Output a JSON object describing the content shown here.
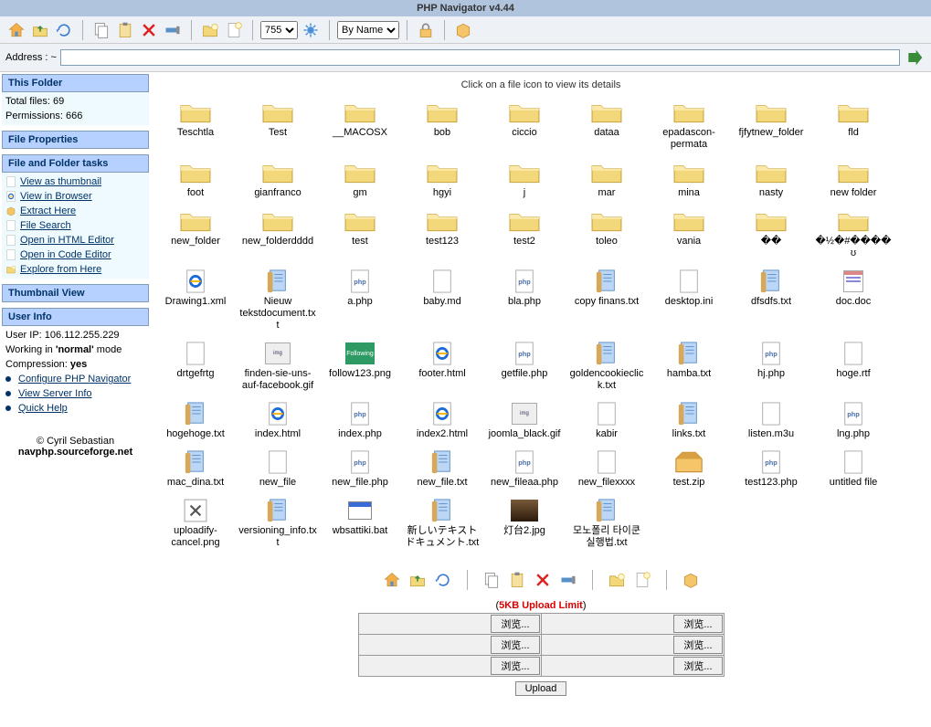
{
  "title": "PHP Navigator v4.44",
  "address_label": "Address : ~",
  "address_value": "",
  "permission_select": "755",
  "sort_select": "By Name",
  "sidebar": {
    "this_folder": {
      "header": "This Folder",
      "total_files": "Total files: 69",
      "permissions": "Permissions: 666"
    },
    "file_properties": {
      "header": "File Properties"
    },
    "tasks": {
      "header": "File and Folder tasks",
      "items": [
        "View as thumbnail",
        "View in Browser",
        "Extract Here",
        "File Search",
        "Open in HTML Editor",
        "Open in Code Editor",
        "Explore from Here"
      ]
    },
    "thumbnail_view": {
      "header": "Thumbnail View"
    },
    "user_info": {
      "header": "User Info",
      "ip_line": "User IP: 106.112.255.229",
      "mode_prefix": "Working in ",
      "mode_bold": "'normal'",
      "mode_suffix": " mode",
      "comp_prefix": "Compression: ",
      "comp_bold": "yes",
      "links": [
        "Configure PHP Navigator",
        "View Server Info",
        "Quick Help"
      ]
    },
    "credit_line1": "© Cyril Sebastian",
    "credit_line2": "navphp.sourceforge.net"
  },
  "hint": "Click on a file icon to view its details",
  "files": [
    {
      "name": "Teschtla",
      "type": "folder"
    },
    {
      "name": "Test",
      "type": "folder"
    },
    {
      "name": "__MACOSX",
      "type": "folder"
    },
    {
      "name": "bob",
      "type": "folder"
    },
    {
      "name": "ciccio",
      "type": "folder"
    },
    {
      "name": "dataa",
      "type": "folder"
    },
    {
      "name": "epadascon-permata",
      "type": "folder"
    },
    {
      "name": "fjfytnew_folder",
      "type": "folder"
    },
    {
      "name": "fld",
      "type": "folder"
    },
    {
      "name": "foot",
      "type": "folder"
    },
    {
      "name": "gianfranco",
      "type": "folder"
    },
    {
      "name": "gm",
      "type": "folder"
    },
    {
      "name": "hgyi",
      "type": "folder"
    },
    {
      "name": "j",
      "type": "folder"
    },
    {
      "name": "mar",
      "type": "folder"
    },
    {
      "name": "mina",
      "type": "folder"
    },
    {
      "name": "nasty",
      "type": "folder"
    },
    {
      "name": "new folder",
      "type": "folder"
    },
    {
      "name": "new_folder",
      "type": "folder"
    },
    {
      "name": "new_folderdddd",
      "type": "folder"
    },
    {
      "name": "test",
      "type": "folder"
    },
    {
      "name": "test123",
      "type": "folder"
    },
    {
      "name": "test2",
      "type": "folder"
    },
    {
      "name": "toleo",
      "type": "folder"
    },
    {
      "name": "vania",
      "type": "folder"
    },
    {
      "name": "��",
      "type": "folder"
    },
    {
      "name": "�½�#����ʊ",
      "type": "folder"
    },
    {
      "name": "Drawing1.xml",
      "type": "ie"
    },
    {
      "name": "Nieuw tekstdocument.txt",
      "type": "txt"
    },
    {
      "name": "a.php",
      "type": "php"
    },
    {
      "name": "baby.md",
      "type": "blank"
    },
    {
      "name": "bla.php",
      "type": "php"
    },
    {
      "name": "copy finans.txt",
      "type": "txt"
    },
    {
      "name": "desktop.ini",
      "type": "blank"
    },
    {
      "name": "dfsdfs.txt",
      "type": "txt"
    },
    {
      "name": "doc.doc",
      "type": "doc"
    },
    {
      "name": "drtgefrtg",
      "type": "blank"
    },
    {
      "name": "finden-sie-uns-auf-facebook.gif",
      "type": "img"
    },
    {
      "name": "follow123.png",
      "type": "img2"
    },
    {
      "name": "footer.html",
      "type": "ie"
    },
    {
      "name": "getfile.php",
      "type": "php"
    },
    {
      "name": "goldencookieclick.txt",
      "type": "txt"
    },
    {
      "name": "hamba.txt",
      "type": "txt"
    },
    {
      "name": "hj.php",
      "type": "php"
    },
    {
      "name": "hoge.rtf",
      "type": "blank"
    },
    {
      "name": "hogehoge.txt",
      "type": "txt"
    },
    {
      "name": "index.html",
      "type": "ie"
    },
    {
      "name": "index.php",
      "type": "php"
    },
    {
      "name": "index2.html",
      "type": "ie"
    },
    {
      "name": "joomla_black.gif",
      "type": "img"
    },
    {
      "name": "kabir",
      "type": "blank"
    },
    {
      "name": "links.txt",
      "type": "txt"
    },
    {
      "name": "listen.m3u",
      "type": "blank"
    },
    {
      "name": "lng.php",
      "type": "php"
    },
    {
      "name": "mac_dina.txt",
      "type": "txt"
    },
    {
      "name": "new_file",
      "type": "blank"
    },
    {
      "name": "new_file.php",
      "type": "php"
    },
    {
      "name": "new_file.txt",
      "type": "txt"
    },
    {
      "name": "new_fileaa.php",
      "type": "php"
    },
    {
      "name": "new_filexxxx",
      "type": "blank"
    },
    {
      "name": "test.zip",
      "type": "zip"
    },
    {
      "name": "test123.php",
      "type": "php"
    },
    {
      "name": "untitled file",
      "type": "blank"
    },
    {
      "name": "uploadify-cancel.png",
      "type": "x"
    },
    {
      "name": "versioning_info.txt",
      "type": "txt"
    },
    {
      "name": "wbsattiki.bat",
      "type": "bat"
    },
    {
      "name": "新しいテキスト ドキュメント.txt",
      "type": "txt"
    },
    {
      "name": "灯台2.jpg",
      "type": "img3"
    },
    {
      "name": "모노폴리 타이쿤 실행법.txt",
      "type": "txt"
    }
  ],
  "upload_limit_open": "(",
  "upload_limit_red": "5KB Upload Limit",
  "upload_limit_close": ")",
  "browse_label": "浏览...",
  "upload_label": "Upload"
}
